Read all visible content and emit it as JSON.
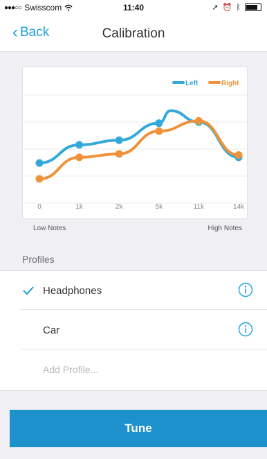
{
  "status_bar": {
    "signal_dots": "●●●○○",
    "carrier": "Swisscom",
    "wifi_icon": "wifi-icon",
    "time": "11:40",
    "right_icons": [
      "location-icon",
      "alarm-icon",
      "bluetooth-icon",
      "battery-icon"
    ]
  },
  "nav": {
    "back_label": "Back",
    "title": "Calibration"
  },
  "chart_data": {
    "type": "line",
    "categories": [
      "0",
      "1k",
      "2k",
      "5k",
      "11k",
      "14k"
    ],
    "series": [
      {
        "name": "Left",
        "color": "#33a9d9",
        "values": [
          0.28,
          0.44,
          0.48,
          0.63,
          0.64,
          0.33
        ]
      },
      {
        "name": "Right",
        "color": "#f0923a",
        "values": [
          0.14,
          0.33,
          0.36,
          0.56,
          0.65,
          0.35
        ]
      }
    ],
    "peak": {
      "between": "5k-11k",
      "value": 0.74,
      "series": "Left"
    },
    "range_low_label": "Low Notes",
    "range_high_label": "High Notes",
    "grid": true,
    "legend": "top-right"
  },
  "profiles": {
    "header": "Profiles",
    "items": [
      {
        "label": "Headphones",
        "checked": true
      },
      {
        "label": "Car",
        "checked": false
      }
    ],
    "add_placeholder": "Add Profile..."
  },
  "tune_label": "Tune",
  "colors": {
    "accent": "#1ba1dc",
    "button": "#1d91cc",
    "left_series": "#33a9d9",
    "right_series": "#f0923a"
  }
}
